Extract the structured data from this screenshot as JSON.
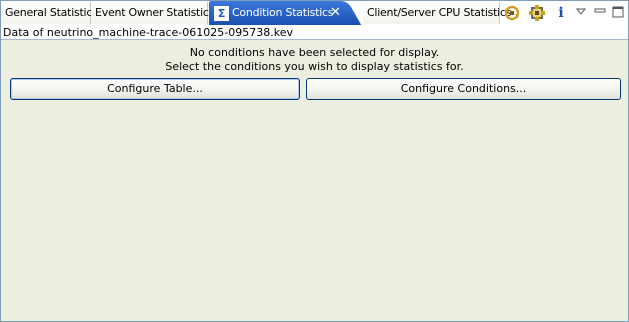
{
  "tabs": [
    {
      "label": "General Statistics"
    },
    {
      "label": "Event Owner Statistics"
    },
    {
      "label": "Condition Statistics"
    },
    {
      "label": "Client/Server CPU Statistics"
    }
  ],
  "active_tab_icon": "Σ",
  "active_tab_close": "✕",
  "toolbar": {
    "icons": [
      "sync-icon",
      "gear-icon",
      "info-icon",
      "view-menu-icon",
      "minimize-icon",
      "maximize-icon"
    ],
    "info_glyph": "i"
  },
  "content": {
    "data_header": "Data of neutrino_machine-trace-061025-095738.kev",
    "message_line1": "No conditions have been selected for display.",
    "message_line2": "Select the conditions you wish to display statistics for.",
    "configure_table_label": "Configure Table...",
    "configure_conditions_label": "Configure Conditions..."
  },
  "colors": {
    "active_tab": "#1f5cc5",
    "background": "#eeeee0",
    "border": "#7f9db9"
  }
}
